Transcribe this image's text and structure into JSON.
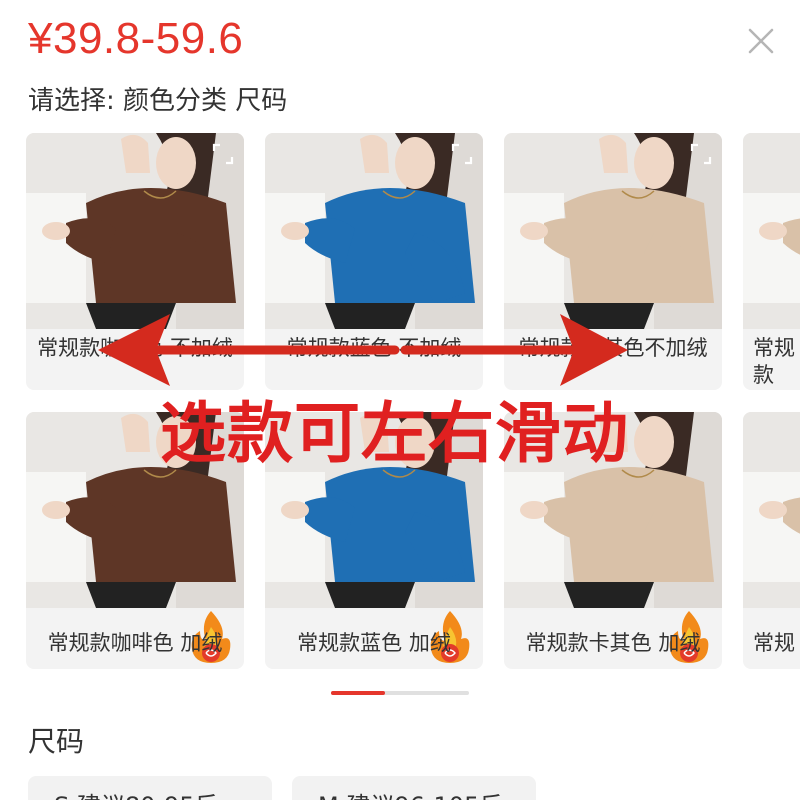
{
  "header": {
    "price": "¥39.8-59.6",
    "prompt": "请选择: 颜色分类 尺码"
  },
  "colors": {
    "brown": "#5e3626",
    "blue": "#1f6fb4",
    "khaki": "#d9c1a8",
    "accent": "#e5362c"
  },
  "variants_row1": [
    {
      "label": "常规款咖啡色 不加绒",
      "color": "#5e3626"
    },
    {
      "label": "常规款蓝色 不加绒",
      "color": "#1f6fb4"
    },
    {
      "label": "常规款卡其色不加绒",
      "color": "#d9c1a8"
    },
    {
      "label": "常规款",
      "color": "#d9c1a8"
    }
  ],
  "variants_row2": [
    {
      "label": "常规款咖啡色 加绒",
      "color": "#5e3626"
    },
    {
      "label": "常规款蓝色 加绒",
      "color": "#1f6fb4"
    },
    {
      "label": "常规款卡其色 加绒",
      "color": "#d9c1a8"
    },
    {
      "label": "常规",
      "color": "#d9c1a8"
    }
  ],
  "overlay": {
    "text": "选款可左右滑动"
  },
  "sizes": {
    "title": "尺码",
    "options": [
      "S 建议80-95斤",
      "M 建议96-105斤"
    ]
  },
  "icons": {
    "close": "close-icon",
    "expand": "expand-icon",
    "plush": "warm-plush-badge-icon"
  }
}
